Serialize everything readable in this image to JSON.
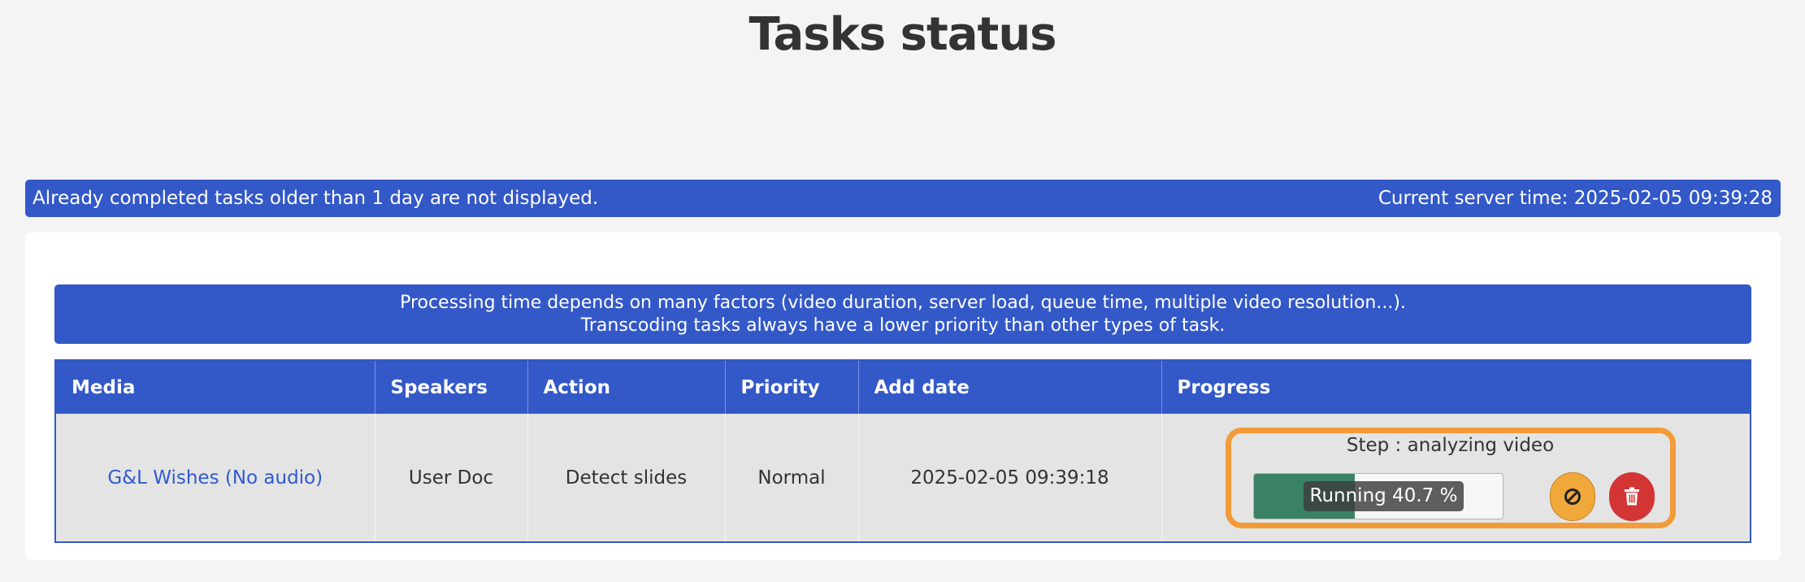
{
  "page": {
    "title": "Tasks status"
  },
  "info_bar": {
    "left_text": "Already completed tasks older than 1 day are not displayed.",
    "server_time": "Current server time: 2025-02-05 09:39:28"
  },
  "notice": {
    "line1": "Processing time depends on many factors (video duration, server load, queue time, multiple video resolution...).",
    "line2": "Transcoding tasks always have a lower priority than other types of task."
  },
  "table": {
    "headers": [
      "Media",
      "Speakers",
      "Action",
      "Priority",
      "Add date",
      "Progress"
    ],
    "rows": [
      {
        "media": "G&L Wishes (No audio)",
        "speakers": "User Doc",
        "action": "Detect slides",
        "priority": "Normal",
        "add_date": "2025-02-05 09:39:18",
        "progress": {
          "step": "Step : analyzing video",
          "label": "Running 40.7 %",
          "percent": 40.7,
          "cancel_icon": "cancel-icon",
          "delete_icon": "trash-icon"
        }
      }
    ]
  },
  "colors": {
    "primary": "#3358c8",
    "progress_fill": "#3a8266",
    "highlight_border": "#f29b38",
    "cancel_button": "#f1a83b",
    "delete_button": "#d33535",
    "link": "#2f5ad0"
  }
}
